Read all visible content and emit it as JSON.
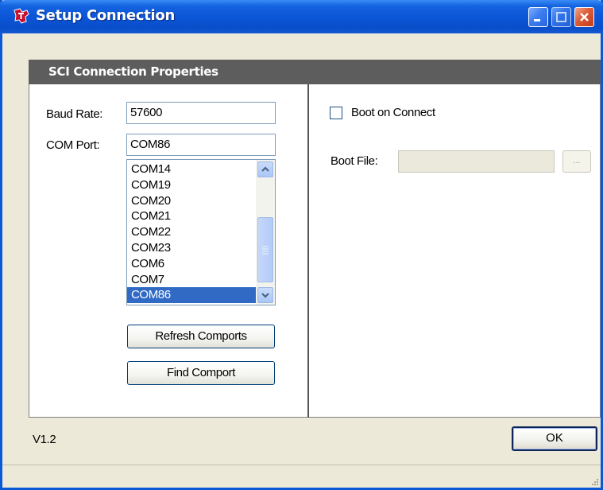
{
  "window": {
    "title": "Setup Connection"
  },
  "panel": {
    "header": "SCI Connection Properties"
  },
  "left": {
    "baud_rate_label": "Baud Rate:",
    "baud_rate_value": "57600",
    "com_port_label": "COM Port:",
    "com_port_value": "COM86",
    "com_port_list": [
      "COM14",
      "COM19",
      "COM20",
      "COM21",
      "COM22",
      "COM23",
      "COM6",
      "COM7",
      "COM86"
    ],
    "selected_port": "COM86",
    "refresh_button": "Refresh Comports",
    "find_button": "Find Comport"
  },
  "right": {
    "boot_on_connect_label": "Boot on Connect",
    "boot_on_connect_checked": false,
    "boot_file_label": "Boot File:",
    "boot_file_value": "",
    "browse_label": "..."
  },
  "footer": {
    "version": "V1.2",
    "ok_button": "OK"
  },
  "colors": {
    "titlebar": "#0a54d6",
    "panel_header": "#5d5d5d",
    "selection": "#316ac5",
    "window_bg": "#ece9d8"
  },
  "icons": {
    "app": "ti-logo-icon",
    "minimize": "minimize-icon",
    "maximize": "maximize-icon",
    "close": "close-icon"
  }
}
